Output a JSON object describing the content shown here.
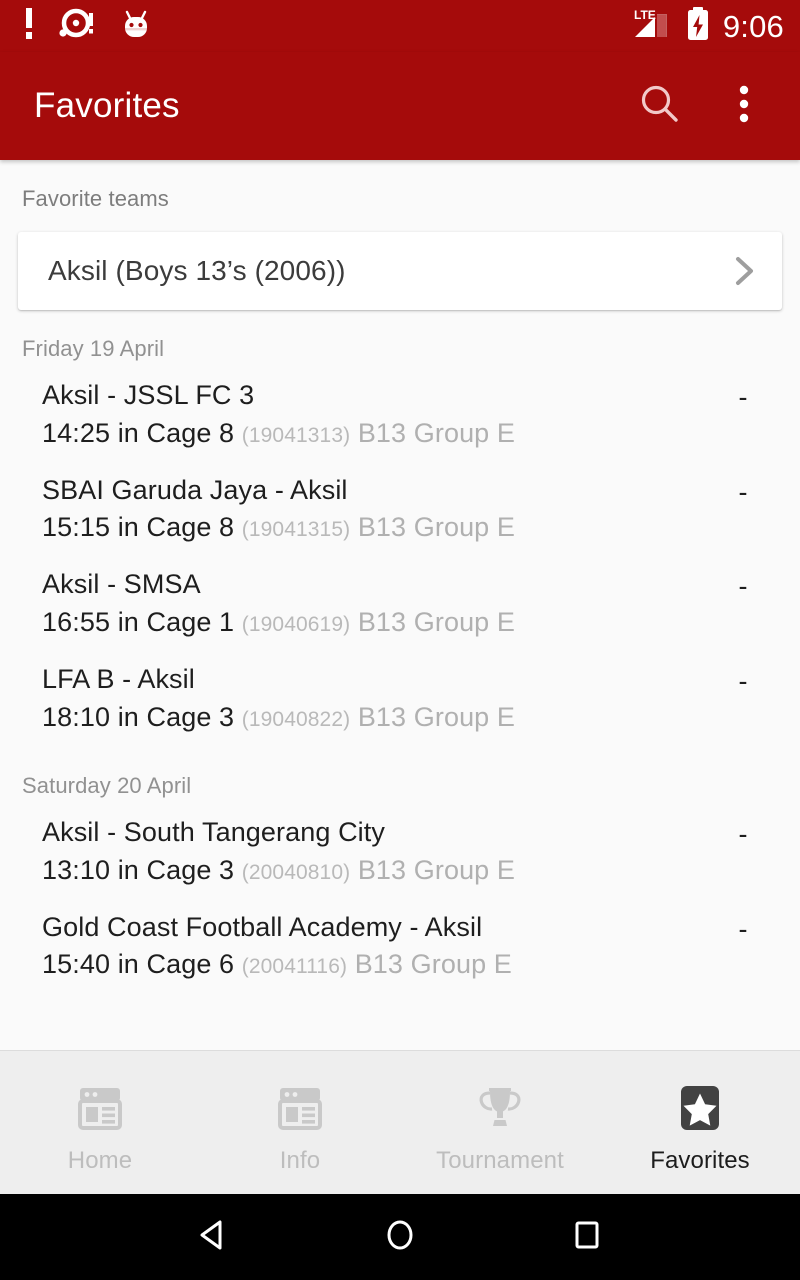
{
  "status_bar": {
    "icons": [
      "alert-exclamation-icon",
      "disc-alert-icon",
      "android-robot-icon"
    ],
    "network_label": "LTE",
    "battery": "battery-charging-icon",
    "time": "9:06"
  },
  "app_bar": {
    "title": "Favorites",
    "search_label": "search-icon",
    "overflow_label": "more-vert-icon",
    "background_color": "#a50b0b"
  },
  "content": {
    "favorite_teams_label": "Favorite teams",
    "favorite_team": {
      "name": "Aksil (Boys 13’s (2006))",
      "chevron": "chevron-right-icon"
    },
    "days": [
      {
        "date": "Friday 19 April",
        "matches": [
          {
            "teams": "Aksil - JSSL FC 3",
            "time": "14:25",
            "venue": "in Cage 8",
            "match_id": "(19041313)",
            "group": "B13 Group E",
            "score": "-"
          },
          {
            "teams": "SBAI Garuda Jaya - Aksil",
            "time": "15:15",
            "venue": "in Cage 8",
            "match_id": "(19041315)",
            "group": "B13 Group E",
            "score": "-"
          },
          {
            "teams": "Aksil - SMSA",
            "time": "16:55",
            "venue": "in Cage 1",
            "match_id": "(19040619)",
            "group": "B13 Group E",
            "score": "-"
          },
          {
            "teams": "LFA B - Aksil",
            "time": "18:10",
            "venue": "in Cage 3",
            "match_id": "(19040822)",
            "group": "B13 Group E",
            "score": "-"
          }
        ]
      },
      {
        "date": "Saturday 20 April",
        "matches": [
          {
            "teams": "Aksil - South Tangerang City",
            "time": "13:10",
            "venue": "in Cage 3",
            "match_id": "(20040810)",
            "group": "B13 Group E",
            "score": "-"
          },
          {
            "teams": "Gold Coast Football Academy - Aksil",
            "time": "15:40",
            "venue": "in Cage 6",
            "match_id": "(20041116)",
            "group": "B13 Group E",
            "score": "-"
          }
        ]
      }
    ]
  },
  "tab_bar": {
    "tabs": [
      {
        "label": "Home",
        "icon": "newspaper-icon",
        "active": false
      },
      {
        "label": "Info",
        "icon": "newspaper-icon",
        "active": false
      },
      {
        "label": "Tournament",
        "icon": "trophy-icon",
        "active": false
      },
      {
        "label": "Favorites",
        "icon": "star-icon",
        "active": true
      }
    ]
  },
  "nav_bar": {
    "back": "back-triangle-icon",
    "home": "home-circle-icon",
    "recents": "recents-square-icon"
  }
}
